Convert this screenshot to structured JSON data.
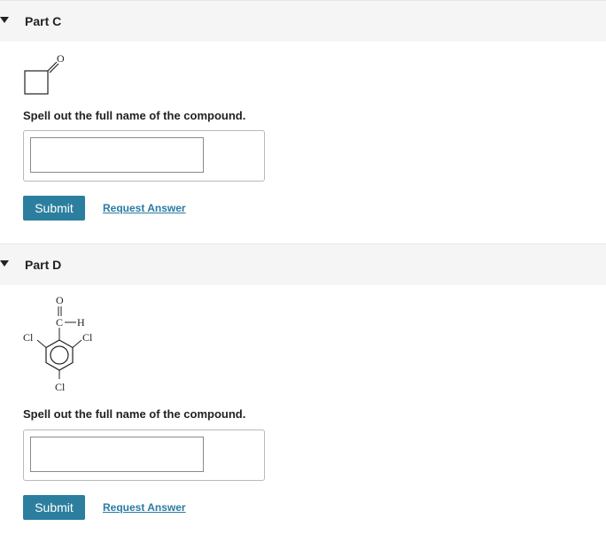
{
  "part_c": {
    "title": "Part C",
    "structure": {
      "icon": "cyclobutanone-structure",
      "atom_labels": [
        "O"
      ]
    },
    "prompt": "Spell out the full name of the compound.",
    "answer_value": "",
    "submit_label": "Submit",
    "request_label": "Request Answer"
  },
  "part_d": {
    "title": "Part D",
    "structure": {
      "icon": "trichlorobenzaldehyde-structure",
      "atom_labels": [
        "O",
        "C",
        "H",
        "Cl",
        "Cl",
        "Cl"
      ]
    },
    "prompt": "Spell out the full name of the compound.",
    "answer_value": "",
    "submit_label": "Submit",
    "request_label": "Request Answer"
  },
  "colors": {
    "submit_bg": "#2b7e9e",
    "link": "#2a7ba2",
    "header_bg": "#f5f5f5"
  }
}
